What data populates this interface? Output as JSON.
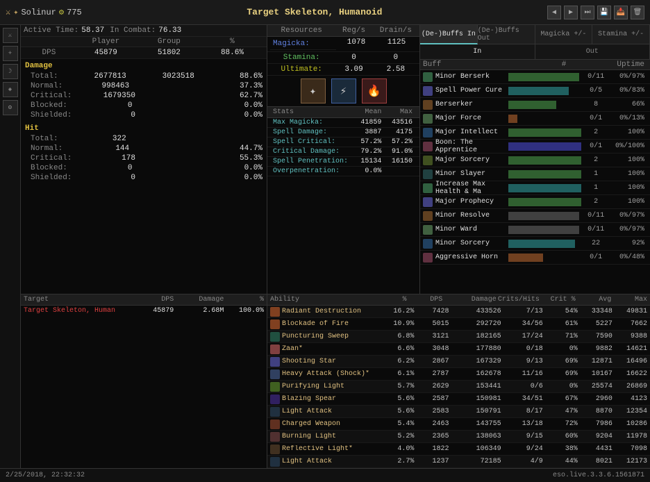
{
  "topbar": {
    "left": "Solinur",
    "icon_level": "775",
    "title": "Target Skeleton, Humanoid",
    "nav_icons": [
      "◀",
      "▶",
      "⏭",
      "💾",
      "📥",
      "🗑"
    ]
  },
  "active_time": {
    "label": "Active Time:",
    "value": "58.37",
    "in_combat_label": "In Combat:",
    "in_combat_value": "76.33"
  },
  "dps_header": [
    "",
    "Player",
    "Group",
    "%"
  ],
  "dps_row": {
    "label": "DPS",
    "player": "45879",
    "group": "51802",
    "pct": "88.6%"
  },
  "damage": {
    "title": "Damage",
    "rows": [
      {
        "label": "Total:",
        "v1": "2677813",
        "v2": "3023518",
        "pct": "88.6%"
      },
      {
        "label": "Normal:",
        "v1": "998463",
        "v2": "",
        "pct": "37.3%"
      },
      {
        "label": "Critical:",
        "v1": "1679350",
        "v2": "",
        "pct": "62.7%"
      },
      {
        "label": "Blocked:",
        "v1": "0",
        "v2": "",
        "pct": "0.0%"
      },
      {
        "label": "Shielded:",
        "v1": "0",
        "v2": "",
        "pct": "0.0%"
      }
    ]
  },
  "hit": {
    "title": "Hit",
    "rows": [
      {
        "label": "Total:",
        "v1": "322",
        "v2": "",
        "pct": ""
      },
      {
        "label": "Normal:",
        "v1": "144",
        "v2": "",
        "pct": "44.7%"
      },
      {
        "label": "Critical:",
        "v1": "178",
        "v2": "",
        "pct": "55.3%"
      },
      {
        "label": "Blocked:",
        "v1": "0",
        "v2": "",
        "pct": "0.0%"
      },
      {
        "label": "Shielded:",
        "v1": "0",
        "v2": "",
        "pct": "0.0%"
      }
    ]
  },
  "resources": {
    "header": [
      "Resources",
      "Reg/s",
      "Drain/s"
    ],
    "rows": [
      {
        "name": "Magicka:",
        "reg": "1078",
        "drain": "1125",
        "type": "magicka"
      },
      {
        "name": "Stamina:",
        "reg": "0",
        "drain": "0",
        "type": "stamina"
      },
      {
        "name": "Ultimate:",
        "reg": "3.09",
        "drain": "2.58",
        "type": "ultimate"
      }
    ]
  },
  "stats": {
    "header": [
      "Stats",
      "Mean",
      "Max"
    ],
    "rows": [
      {
        "label": "Max Magicka:",
        "mean": "41859",
        "max": "43516"
      },
      {
        "label": "Spell Damage:",
        "mean": "3887",
        "max": "4175"
      },
      {
        "label": "Spell Critical:",
        "mean": "57.2%",
        "max": "57.2%"
      },
      {
        "label": "Critical Damage:",
        "mean": "79.2%",
        "max": "91.0%"
      },
      {
        "label": "Spell Penetration:",
        "mean": "15134",
        "max": "16150"
      },
      {
        "label": "Overpenetration:",
        "mean": "0.0%",
        "max": ""
      }
    ]
  },
  "buffs": {
    "tabs": [
      "(De-)Buffs In",
      "(De-)Buffs Out",
      "Magicka +/-",
      "Stamina +/-"
    ],
    "active_tab": 0,
    "sub_tabs": [
      "In",
      "Out"
    ],
    "active_sub": 0,
    "columns": [
      "Buff",
      "#",
      "Uptime"
    ],
    "rows": [
      {
        "name": "Minor Berserk",
        "count": "0/11",
        "uptime": "0%/97%",
        "bar": 97,
        "color": "bar-green",
        "active": false
      },
      {
        "name": "Spell Power Cure",
        "count": "0/5",
        "uptime": "0%/83%",
        "bar": 83,
        "color": "bar-teal",
        "active": false
      },
      {
        "name": "Berserker",
        "count": "8",
        "uptime": "66%",
        "bar": 66,
        "color": "bar-green",
        "active": true
      },
      {
        "name": "Major Force",
        "count": "0/1",
        "uptime": "0%/13%",
        "bar": 13,
        "color": "bar-orange",
        "active": false
      },
      {
        "name": "Major Intellect",
        "count": "2",
        "uptime": "100%",
        "bar": 100,
        "color": "bar-green",
        "active": true
      },
      {
        "name": "Boon: The Apprentice",
        "count": "0/1",
        "uptime": "0%/100%",
        "bar": 100,
        "color": "bar-blue",
        "active": false
      },
      {
        "name": "Major Sorcery",
        "count": "2",
        "uptime": "100%",
        "bar": 100,
        "color": "bar-green",
        "active": true
      },
      {
        "name": "Minor Slayer",
        "count": "1",
        "uptime": "100%",
        "bar": 100,
        "color": "bar-green",
        "active": true
      },
      {
        "name": "Increase Max Health & Ma",
        "count": "1",
        "uptime": "100%",
        "bar": 100,
        "color": "bar-teal",
        "active": true
      },
      {
        "name": "Major Prophecy",
        "count": "2",
        "uptime": "100%",
        "bar": 100,
        "color": "bar-green",
        "active": true
      },
      {
        "name": "Minor Resolve",
        "count": "0/11",
        "uptime": "0%/97%",
        "bar": 97,
        "color": "bar-gray",
        "active": false
      },
      {
        "name": "Minor Ward",
        "count": "0/11",
        "uptime": "0%/97%",
        "bar": 97,
        "color": "bar-gray",
        "active": false
      },
      {
        "name": "Minor Sorcery",
        "count": "22",
        "uptime": "92%",
        "bar": 92,
        "color": "bar-teal",
        "active": true
      },
      {
        "name": "Aggressive Horn",
        "count": "0/1",
        "uptime": "0%/48%",
        "bar": 48,
        "color": "bar-orange",
        "active": false
      }
    ]
  },
  "target": {
    "headers": [
      "Target",
      "DPS",
      "Damage",
      "%"
    ],
    "rows": [
      {
        "name": "Target Skeleton, Human",
        "dps": "45879",
        "damage": "2.68M",
        "pct": "100.0%"
      }
    ]
  },
  "abilities": {
    "headers": [
      "Ability",
      "%",
      "DPS",
      "Damage",
      "Crits/Hits",
      "Crit %",
      "Avg",
      "Max"
    ],
    "rows": [
      {
        "name": "Radiant Destruction",
        "pct": "16.2%",
        "dps": "7428",
        "damage": "433526",
        "crits": "7/13",
        "critpct": "54%",
        "avg": "33348",
        "max": "49831"
      },
      {
        "name": "Blockade of Fire",
        "pct": "10.9%",
        "dps": "5015",
        "damage": "292720",
        "crits": "34/56",
        "critpct": "61%",
        "avg": "5227",
        "max": "7662"
      },
      {
        "name": "Puncturing Sweep",
        "pct": "6.8%",
        "dps": "3121",
        "damage": "182165",
        "crits": "17/24",
        "critpct": "71%",
        "avg": "7590",
        "max": "9388"
      },
      {
        "name": "Zaan*",
        "pct": "6.6%",
        "dps": "3048",
        "damage": "177880",
        "crits": "0/18",
        "critpct": "0%",
        "avg": "9882",
        "max": "14621"
      },
      {
        "name": "Shooting Star",
        "pct": "6.2%",
        "dps": "2867",
        "damage": "167329",
        "crits": "9/13",
        "critpct": "69%",
        "avg": "12871",
        "max": "16496"
      },
      {
        "name": "Heavy Attack (Shock)*",
        "pct": "6.1%",
        "dps": "2787",
        "damage": "162678",
        "crits": "11/16",
        "critpct": "69%",
        "avg": "10167",
        "max": "16622"
      },
      {
        "name": "Purifying Light",
        "pct": "5.7%",
        "dps": "2629",
        "damage": "153441",
        "crits": "0/6",
        "critpct": "0%",
        "avg": "25574",
        "max": "26869"
      },
      {
        "name": "Blazing Spear",
        "pct": "5.6%",
        "dps": "2587",
        "damage": "150981",
        "crits": "34/51",
        "critpct": "67%",
        "avg": "2960",
        "max": "4123"
      },
      {
        "name": "Light Attack",
        "pct": "5.6%",
        "dps": "2583",
        "damage": "150791",
        "crits": "8/17",
        "critpct": "47%",
        "avg": "8870",
        "max": "12354"
      },
      {
        "name": "Charged Weapon",
        "pct": "5.4%",
        "dps": "2463",
        "damage": "143755",
        "crits": "13/18",
        "critpct": "72%",
        "avg": "7986",
        "max": "10286"
      },
      {
        "name": "Burning Light",
        "pct": "5.2%",
        "dps": "2365",
        "damage": "138063",
        "crits": "9/15",
        "critpct": "60%",
        "avg": "9204",
        "max": "11978"
      },
      {
        "name": "Reflective Light*",
        "pct": "4.0%",
        "dps": "1822",
        "damage": "106349",
        "crits": "9/24",
        "critpct": "38%",
        "avg": "4431",
        "max": "7098"
      },
      {
        "name": "Light Attack",
        "pct": "2.7%",
        "dps": "1237",
        "damage": "72185",
        "crits": "4/9",
        "critpct": "44%",
        "avg": "8021",
        "max": "12173"
      }
    ]
  },
  "status_bar": {
    "left": "2/25/2018, 22:32:32",
    "right": "eso.live.3.3.6.1561871"
  }
}
